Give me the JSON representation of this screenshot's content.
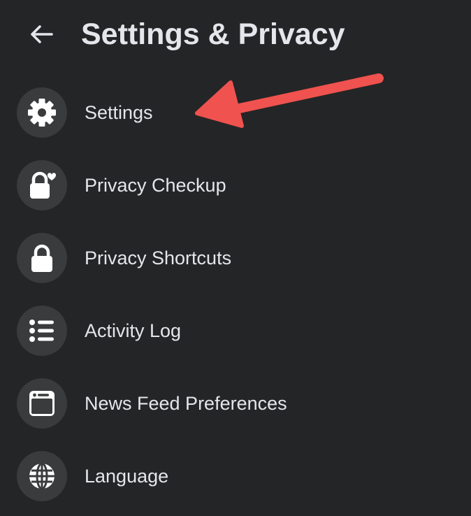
{
  "header": {
    "title": "Settings & Privacy"
  },
  "menu": {
    "items": [
      {
        "label": "Settings",
        "icon": "gear-icon"
      },
      {
        "label": "Privacy Checkup",
        "icon": "lock-heart-icon"
      },
      {
        "label": "Privacy Shortcuts",
        "icon": "lock-icon"
      },
      {
        "label": "Activity Log",
        "icon": "list-icon"
      },
      {
        "label": "News Feed Preferences",
        "icon": "news-feed-icon"
      },
      {
        "label": "Language",
        "icon": "globe-icon"
      }
    ]
  },
  "colors": {
    "background": "#242526",
    "icon_circle": "#3a3b3c",
    "text": "#e4e6eb",
    "annotation_arrow": "#f0524f"
  }
}
